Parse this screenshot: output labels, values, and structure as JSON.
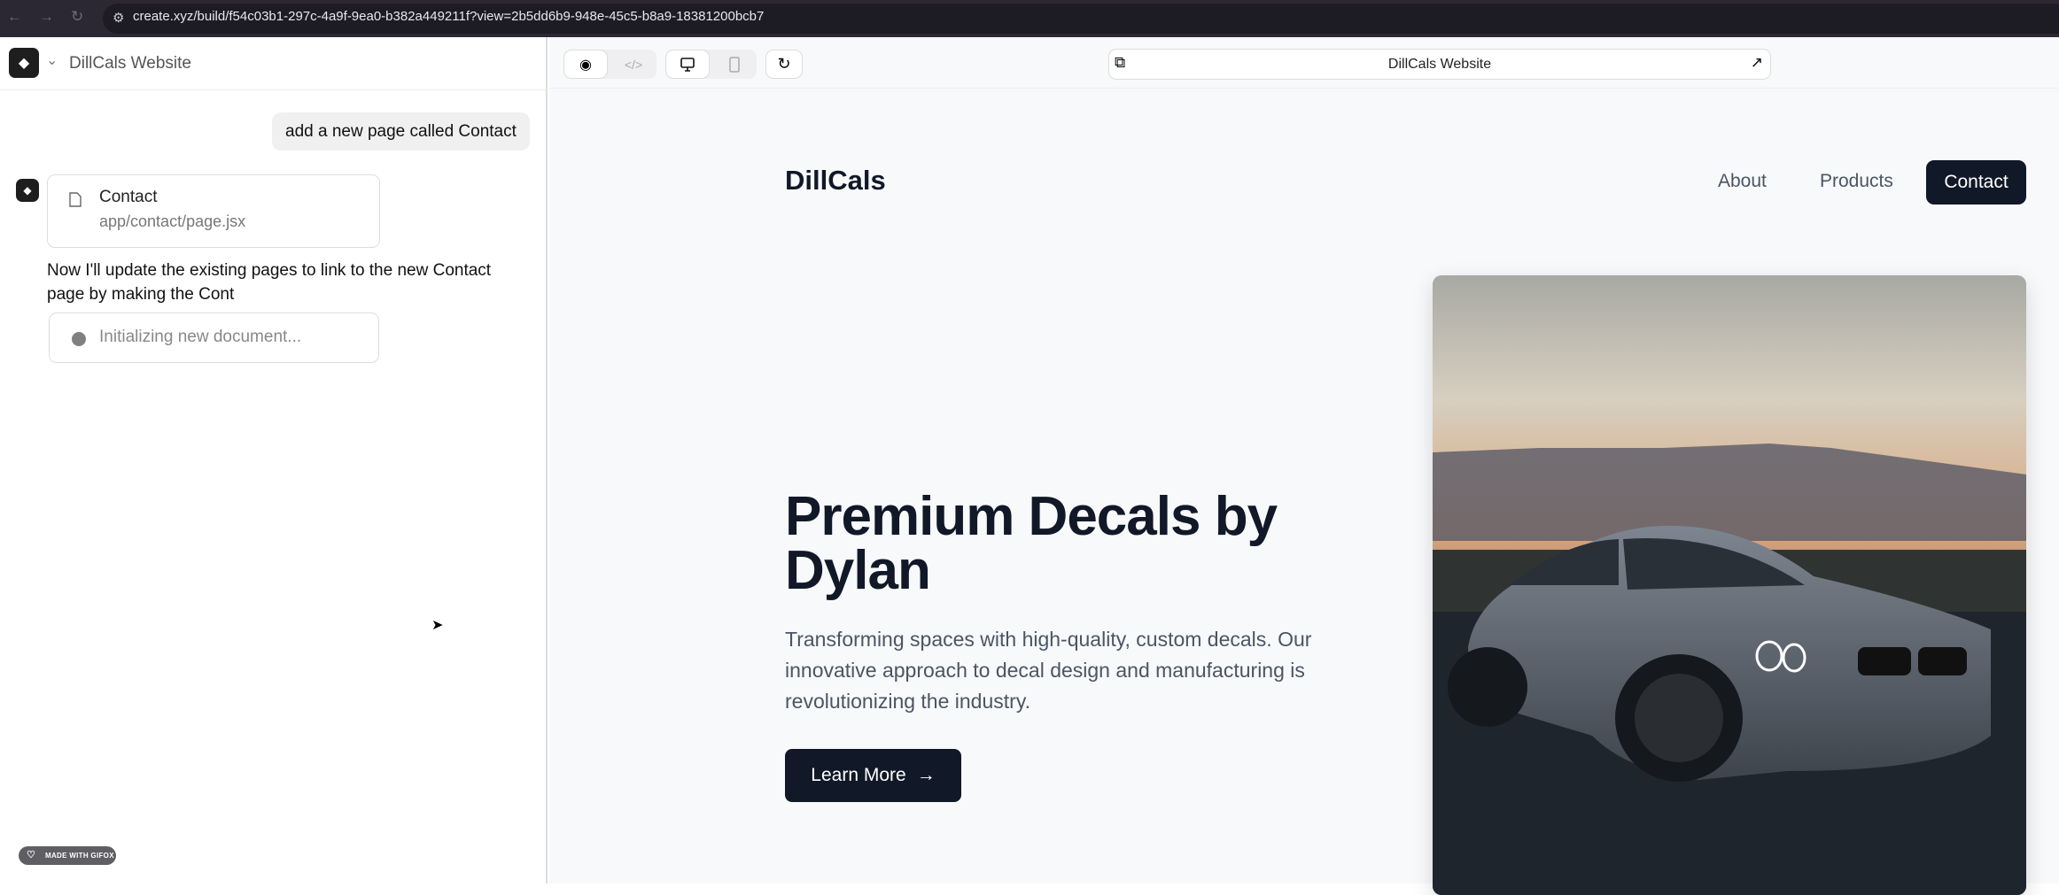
{
  "browser": {
    "url": "create.xyz/build/f54c03b1-297c-4a9f-9ea0-b382a449211f?view=2b5dd6b9-948e-45c5-b8a9-18381200bcb7"
  },
  "sidebar": {
    "project_name": "DillCals Website",
    "user_message": "add a new page called Contact",
    "file_card": {
      "title": "Contact",
      "path": "app/contact/page.jsx"
    },
    "assistant_text": "Now I'll update the existing pages to link to the new Contact page by making the Cont",
    "status_card": {
      "text": "Initializing new document..."
    },
    "badge": "MADE WITH GIFOX"
  },
  "preview": {
    "url_title": "DillCals Website",
    "site": {
      "brand": "DillCals",
      "nav": [
        "About",
        "Products",
        "Contact"
      ],
      "hero_title": "Premium Decals by Dylan",
      "hero_text": "Transforming spaces with high-quality, custom decals. Our innovative approach to decal design and manufacturing is revolutionizing the industry.",
      "cta": "Learn More"
    }
  },
  "colors": {
    "primary": "#111827",
    "text_muted": "#4b5563"
  }
}
